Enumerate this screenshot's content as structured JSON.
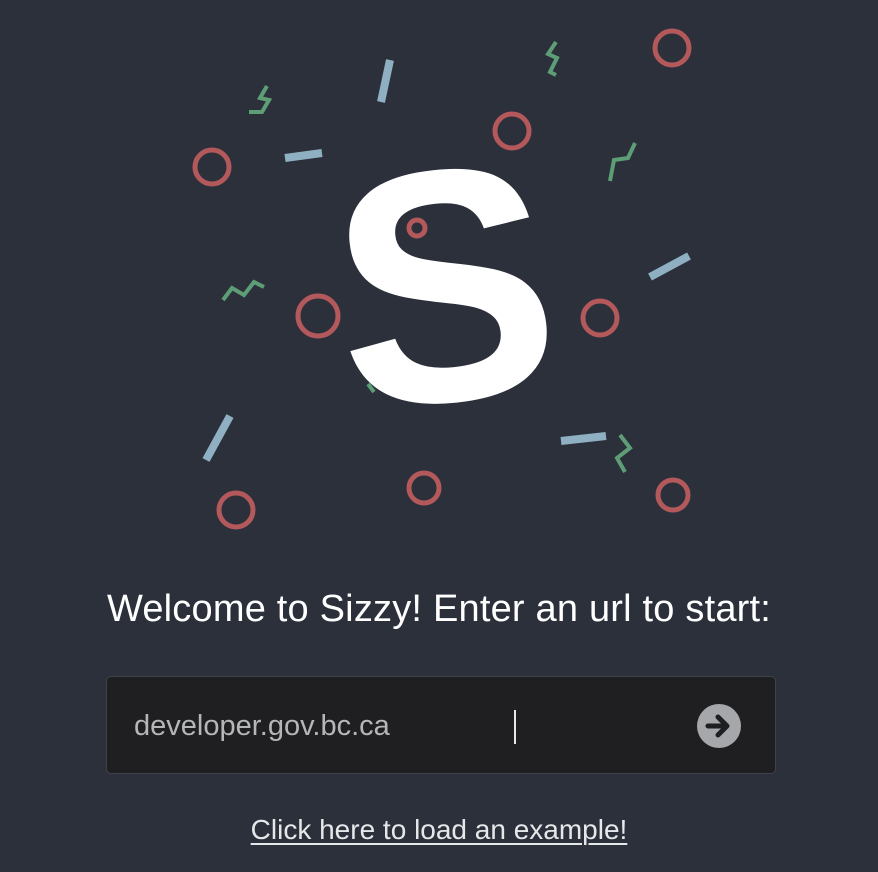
{
  "logo": {
    "letter": "S",
    "icon": "sizzy-logo-icon",
    "confetti_colors": {
      "ring": "#b3585b",
      "dash": "#8fb0c2",
      "zigzag": "#5d9e77"
    }
  },
  "welcome": {
    "text": "Welcome to Sizzy! Enter an url to start:"
  },
  "url_input": {
    "value": "developer.gov.bc.ca",
    "placeholder": ""
  },
  "go_button": {
    "icon": "arrow-right-circle-icon"
  },
  "example_link": {
    "text": "Click here to load an example!"
  },
  "colors": {
    "background": "#2b303b",
    "input_background": "#1f1e20",
    "text": "#ffffff"
  }
}
